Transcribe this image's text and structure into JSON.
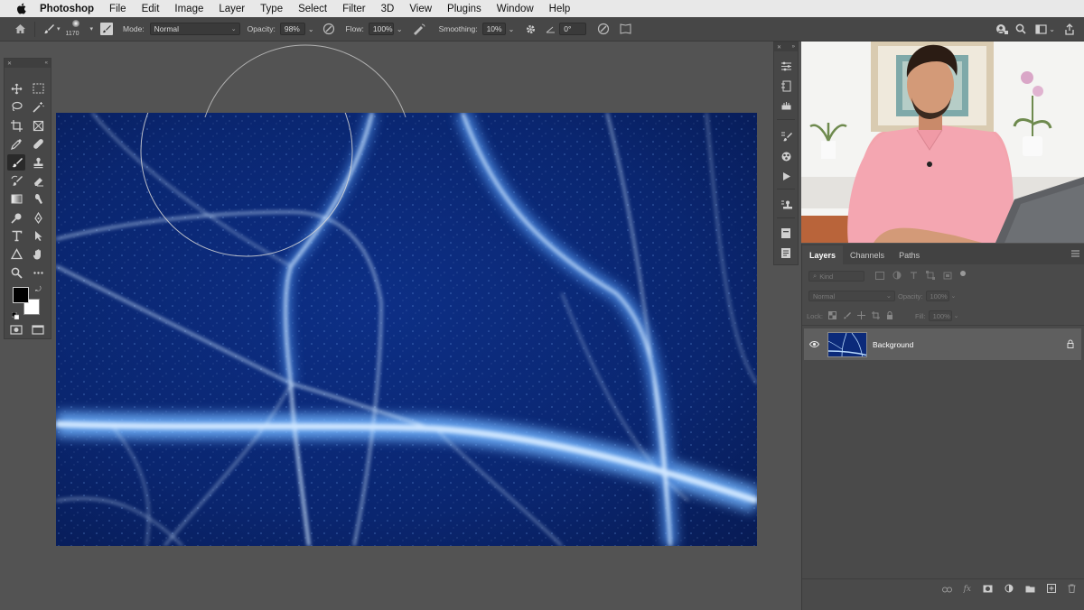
{
  "menubar": {
    "app_name": "Photoshop",
    "items": [
      "File",
      "Edit",
      "Image",
      "Layer",
      "Type",
      "Select",
      "Filter",
      "3D",
      "View",
      "Plugins",
      "Window",
      "Help"
    ]
  },
  "options": {
    "brush_size": "1170",
    "mode_label": "Mode:",
    "mode_value": "Normal",
    "opacity_label": "Opacity:",
    "opacity_value": "98%",
    "flow_label": "Flow:",
    "flow_value": "100%",
    "smoothing_label": "Smoothing:",
    "smoothing_value": "10%",
    "angle_value": "0°"
  },
  "layers_panel": {
    "tabs": [
      "Layers",
      "Channels",
      "Paths"
    ],
    "kind_placeholder": "Kind",
    "blend_mode": "Normal",
    "opacity_label": "Opacity:",
    "opacity_value": "100%",
    "lock_label": "Lock:",
    "fill_label": "Fill:",
    "fill_value": "100%",
    "layer_name": "Background"
  },
  "colors": {
    "foreground": "#000000",
    "background": "#ffffff",
    "canvas_bg": "#535353",
    "ice_blue": "#0a2a7a"
  }
}
